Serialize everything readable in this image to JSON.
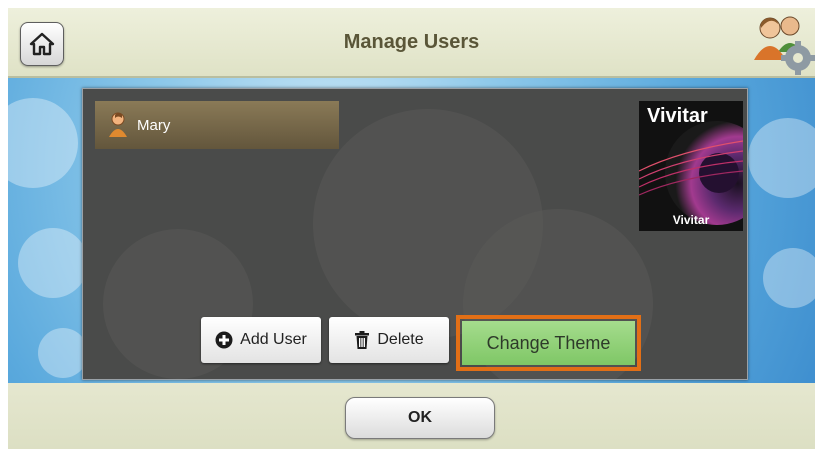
{
  "header": {
    "title": "Manage Users",
    "home_icon": "home-icon",
    "users_icon": "users-settings-icon"
  },
  "users": [
    {
      "name": "Mary",
      "icon": "user-icon"
    }
  ],
  "theme": {
    "brand_text": "Vivitar",
    "caption": "Vivitar"
  },
  "actions": {
    "add_user": "Add User",
    "delete": "Delete",
    "change_theme": "Change Theme",
    "add_icon": "plus-circle-icon",
    "delete_icon": "trash-icon"
  },
  "footer": {
    "ok": "OK"
  },
  "colors": {
    "highlight": "#e26f16",
    "change_theme_bg": "#8fd176",
    "header_bg": "#e6e8cf",
    "panel_bg": "#4a4b4a",
    "user_row_bg": "#7a6c4c"
  }
}
